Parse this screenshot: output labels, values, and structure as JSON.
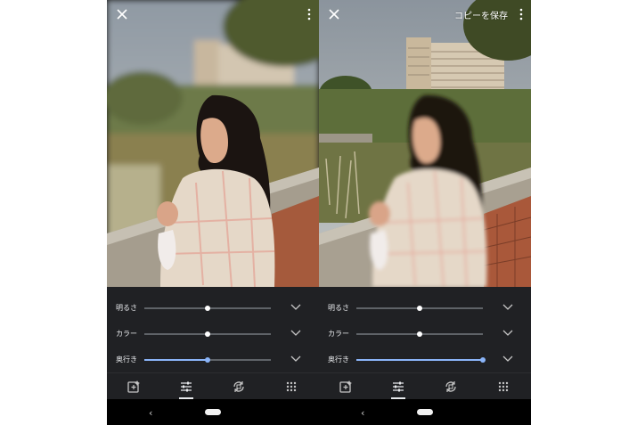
{
  "screens": [
    {
      "id": "left",
      "top_bar": {
        "close_icon": "close-icon",
        "more_icon": "more-vert-icon",
        "save_copy_label": ""
      },
      "adjustments": [
        {
          "label": "明るさ",
          "value": 0.5
        },
        {
          "label": "カラー",
          "value": 0.5
        },
        {
          "label": "奥行き",
          "value": 0.5
        }
      ],
      "tabs": [
        "suggestions-icon",
        "adjust-tune-icon",
        "crop-rotate-icon",
        "filters-grid-icon"
      ],
      "active_tab": 1
    },
    {
      "id": "right",
      "top_bar": {
        "close_icon": "close-icon",
        "more_icon": "more-vert-icon",
        "save_copy_label": "コピーを保存"
      },
      "adjustments": [
        {
          "label": "明るさ",
          "value": 0.5
        },
        {
          "label": "カラー",
          "value": 0.5
        },
        {
          "label": "奥行き",
          "value": 1.0
        }
      ],
      "tabs": [
        "suggestions-icon",
        "adjust-tune-icon",
        "crop-rotate-icon",
        "filters-grid-icon"
      ],
      "active_tab": 1
    }
  ],
  "nav": {
    "back_icon": "nav-back-icon",
    "home_icon": "nav-home-pill-icon"
  },
  "colors": {
    "accent": "#8ab4f8",
    "panel": "#202124",
    "track": "#5f6368"
  }
}
